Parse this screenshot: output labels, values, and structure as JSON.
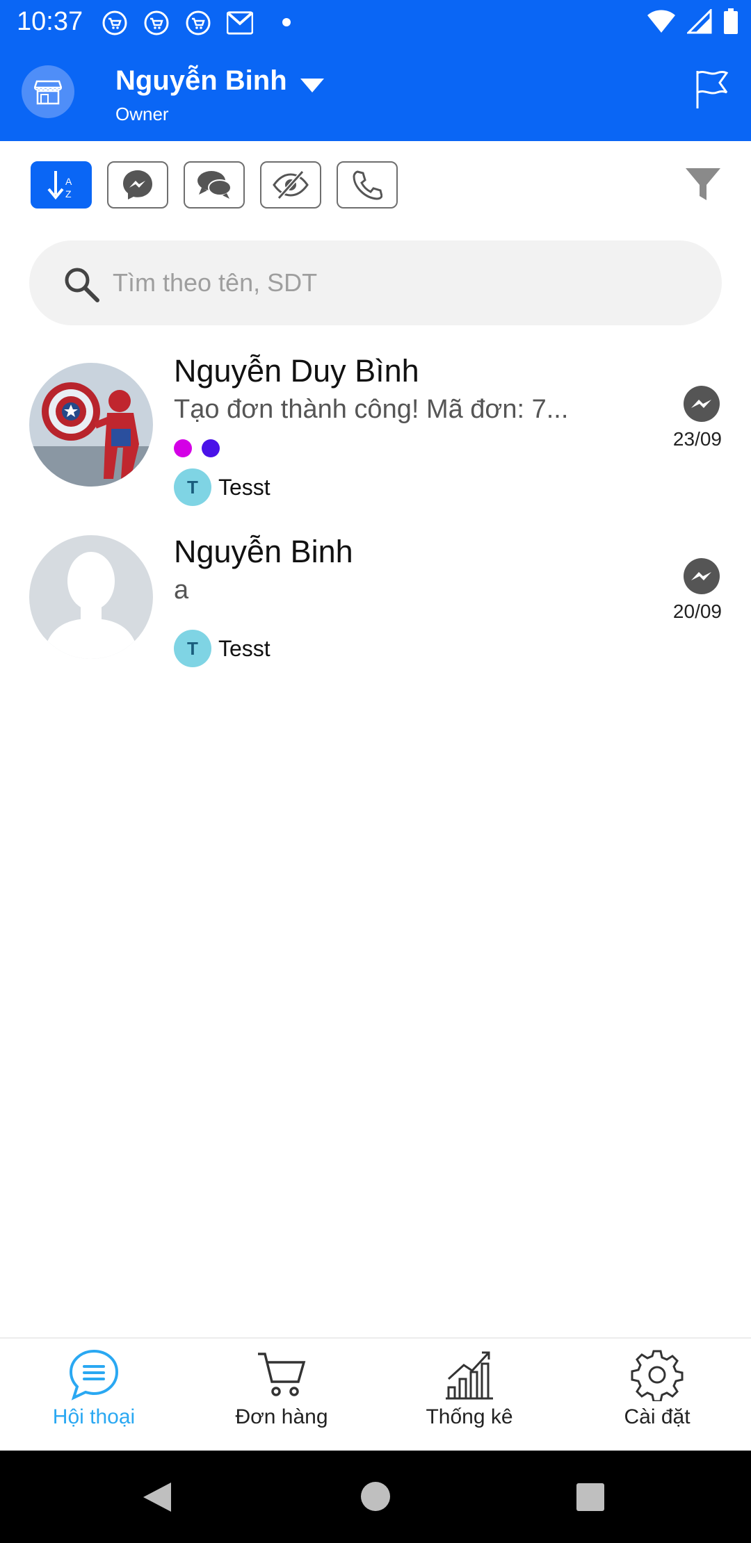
{
  "status_bar": {
    "time": "10:37",
    "notification_icons": [
      "cart-icon",
      "cart-icon",
      "cart-icon",
      "gmail-icon",
      "dot-icon"
    ],
    "system_icons": [
      "wifi-icon",
      "cellular-icon",
      "battery-icon"
    ]
  },
  "header": {
    "user_name": "Nguyễn Binh",
    "role": "Owner",
    "background_color": "#0a66f5"
  },
  "filters": {
    "buttons": [
      {
        "name": "sort-az",
        "icon": "sort-az-icon",
        "active": true
      },
      {
        "name": "messenger",
        "icon": "messenger-icon",
        "active": false
      },
      {
        "name": "comments",
        "icon": "comments-icon",
        "active": false
      },
      {
        "name": "hidden",
        "icon": "eye-slash-icon",
        "active": false
      },
      {
        "name": "phone",
        "icon": "phone-icon",
        "active": false
      }
    ],
    "funnel_icon": "funnel-icon"
  },
  "search": {
    "placeholder": "Tìm theo tên, SDT",
    "value": ""
  },
  "conversations": [
    {
      "name": "Nguyễn Duy Bình",
      "last_message": "Tạo đơn thành công!  Mã đơn: 7...",
      "tags": [
        "#d400e6",
        "#4a12e8"
      ],
      "assignee_initial": "T",
      "assignee": "Tesst",
      "channel": "messenger-icon",
      "date": "23/09"
    },
    {
      "name": "Nguyễn Binh",
      "last_message": "a",
      "tags": [],
      "assignee_initial": "T",
      "assignee": "Tesst",
      "channel": "messenger-icon",
      "date": "20/09"
    }
  ],
  "bottom_nav": [
    {
      "label": "Hội thoại",
      "icon": "chat-icon",
      "active": true
    },
    {
      "label": "Đơn hàng",
      "icon": "cart-icon",
      "active": false
    },
    {
      "label": "Thống kê",
      "icon": "chart-icon",
      "active": false
    },
    {
      "label": "Cài đặt",
      "icon": "gear-icon",
      "active": false
    }
  ],
  "colors": {
    "primary": "#0a66f5",
    "active_nav": "#2aa8f2",
    "assignee_badge": "#7fd4e4"
  }
}
